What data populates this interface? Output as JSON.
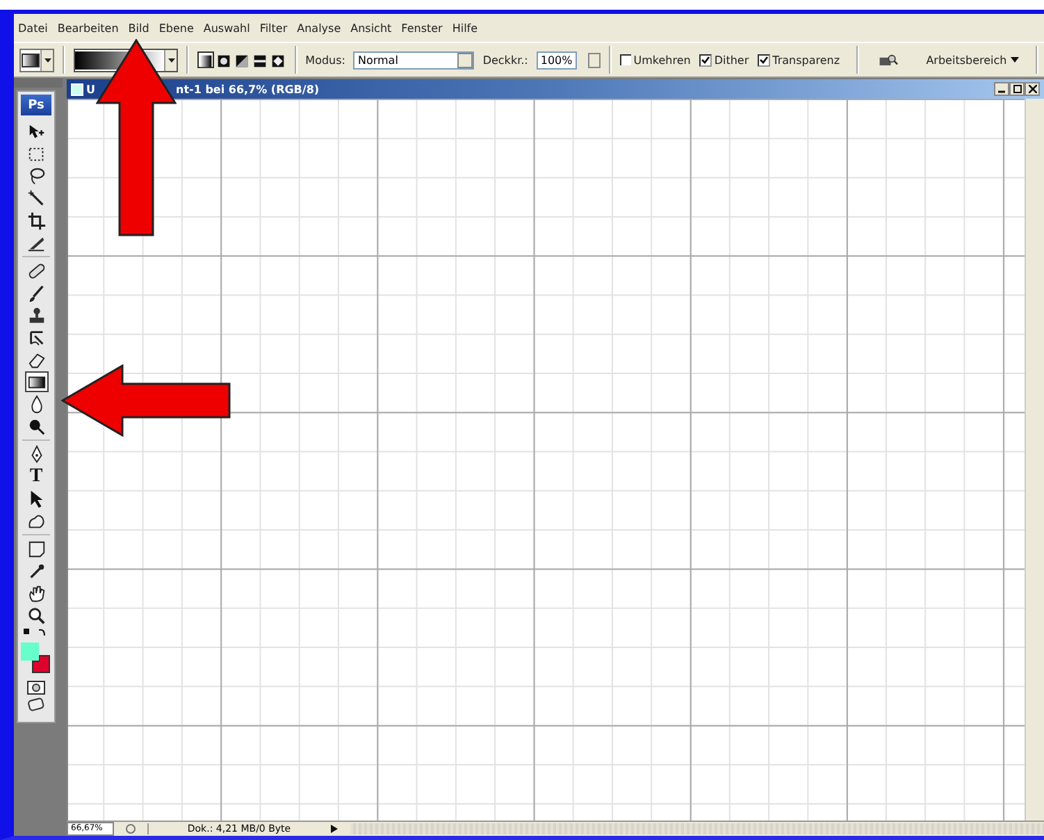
{
  "menu": [
    "Datei",
    "Bearbeiten",
    "Bild",
    "Ebene",
    "Auswahl",
    "Filter",
    "Analyse",
    "Ansicht",
    "Fenster",
    "Hilfe"
  ],
  "options": {
    "gradient_types": [
      {
        "kind": "linear",
        "selected": true
      },
      {
        "kind": "radial",
        "selected": false
      },
      {
        "kind": "angle",
        "selected": false
      },
      {
        "kind": "reflected",
        "selected": false
      },
      {
        "kind": "diamond",
        "selected": false
      }
    ],
    "mode_label": "Modus:",
    "mode_value": "Normal",
    "opacity_label": "Deckkr.:",
    "opacity_value": "100%",
    "checks": [
      {
        "label": "Umkehren",
        "checked": false
      },
      {
        "label": "Dither",
        "checked": true
      },
      {
        "label": "Transparenz",
        "checked": true
      }
    ],
    "workspace": "Arbeitsbereich"
  },
  "toolbox": {
    "logo": "Ps",
    "tools": [
      {
        "kind": "move",
        "selected": false
      },
      {
        "kind": "marquee",
        "selected": false
      },
      {
        "kind": "lasso",
        "selected": false
      },
      {
        "kind": "wand",
        "selected": false
      },
      {
        "kind": "crop",
        "selected": false
      },
      {
        "kind": "slice",
        "selected": false
      },
      {
        "kind": "bandage",
        "selected": false
      },
      {
        "kind": "brush",
        "selected": false
      },
      {
        "kind": "stamp",
        "selected": false
      },
      {
        "kind": "history",
        "selected": false
      },
      {
        "kind": "eraser",
        "selected": false
      },
      {
        "kind": "gradient",
        "selected": true
      },
      {
        "kind": "drop",
        "selected": false
      },
      {
        "kind": "dodge",
        "selected": false
      },
      {
        "kind": "pen",
        "selected": false
      },
      {
        "kind": "type",
        "selected": false
      },
      {
        "kind": "arrow",
        "selected": false
      },
      {
        "kind": "shape",
        "selected": false
      },
      {
        "kind": "note",
        "selected": false
      },
      {
        "kind": "eyedropper",
        "selected": false
      },
      {
        "kind": "hand",
        "selected": false
      },
      {
        "kind": "zoom",
        "selected": false
      }
    ],
    "type_glyph": "T",
    "foreground": {
      "color": "#66ffcc"
    },
    "background": {
      "color": "#e0002c"
    }
  },
  "document": {
    "title_start": "U",
    "title_end": "nt-1 bei 66,7% (RGB/8)"
  },
  "status_bar": {
    "zoom": "66,67%",
    "info": "Dok.: 4,21 MB/0 Byte"
  }
}
